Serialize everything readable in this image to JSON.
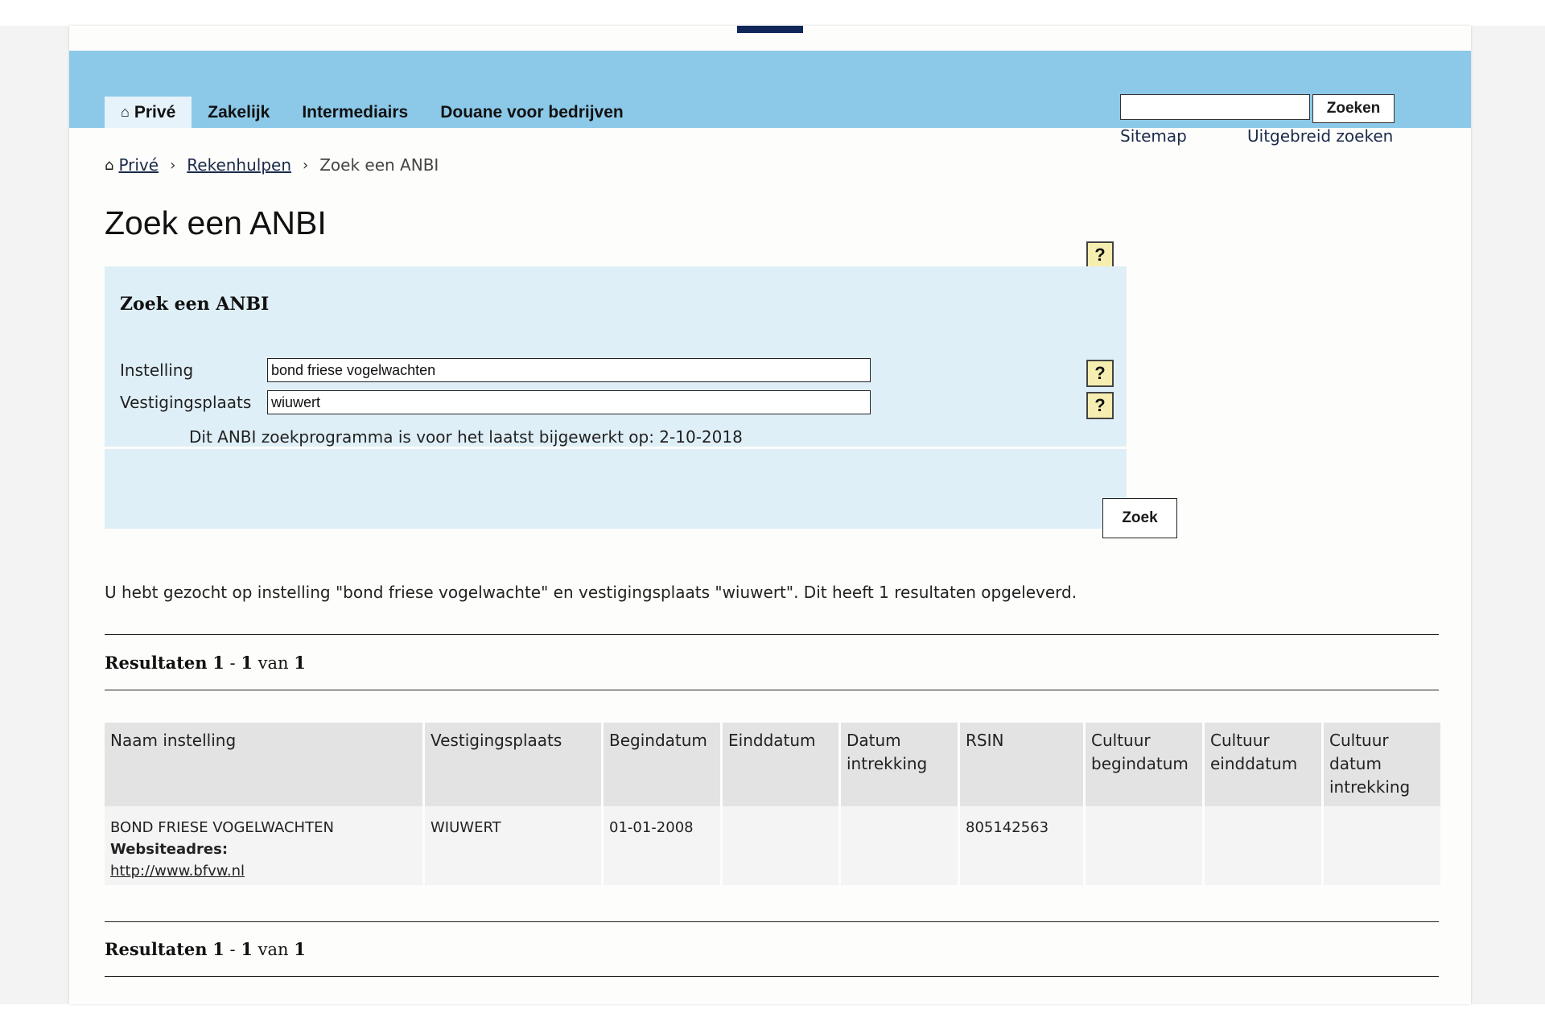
{
  "header": {
    "nav_tabs": [
      "Privé",
      "Zakelijk",
      "Intermediairs",
      "Douane voor bedrijven"
    ],
    "search_input_value": "",
    "search_button_label": "Zoeken",
    "links": {
      "sitemap": "Sitemap",
      "advanced_search": "Uitgebreid zoeken"
    }
  },
  "breadcrumb": {
    "home": "Privé",
    "level2": "Rekenhulpen",
    "current": "Zoek een ANBI",
    "separator": "›"
  },
  "page_title": "Zoek een ANBI",
  "help_label": "?",
  "form": {
    "title": "Zoek een ANBI",
    "fields": [
      {
        "label": "Instelling",
        "value": "bond friese vogelwachten"
      },
      {
        "label": "Vestigingsplaats",
        "value": "wiuwert"
      }
    ],
    "updated_note": "Dit ANBI zoekprogramma is voor het laatst bijgewerkt op: 2-10-2018",
    "submit_label": "Zoek"
  },
  "summary": "U hebt gezocht op instelling \"bond friese vogelwachte\" en vestigingsplaats \"wiuwert\". Dit heeft 1 resultaten opgeleverd.",
  "results": {
    "label": "Resultaten",
    "from": "1",
    "dash": "-",
    "to": "1",
    "of": "van",
    "total": "1"
  },
  "table": {
    "headers": [
      "Naam instelling",
      "Vestigingsplaats",
      "Begindatum",
      "Einddatum",
      "Datum intrekking",
      "RSIN",
      "Cultuur begindatum",
      "Cultuur einddatum",
      "Cultuur datum intrekking"
    ],
    "rows": [
      {
        "name": "BOND FRIESE VOGELWACHTEN",
        "website_label": "Websiteadres:",
        "website_url": "http://www.bfvw.nl",
        "vestigingsplaats": "WIUWERT",
        "begindatum": "01-01-2008",
        "einddatum": "",
        "datum_intrekking": "",
        "rsin": "805142563",
        "cultuur_begindatum": "",
        "cultuur_einddatum": "",
        "cultuur_datum_intrekking": ""
      }
    ]
  },
  "colors": {
    "header_band": "#8cc9e8",
    "active_tab": "#e6f3fa",
    "form_panel": "#dfeff7",
    "help_button": "#f6eeb0",
    "top_accent": "#10275a"
  }
}
